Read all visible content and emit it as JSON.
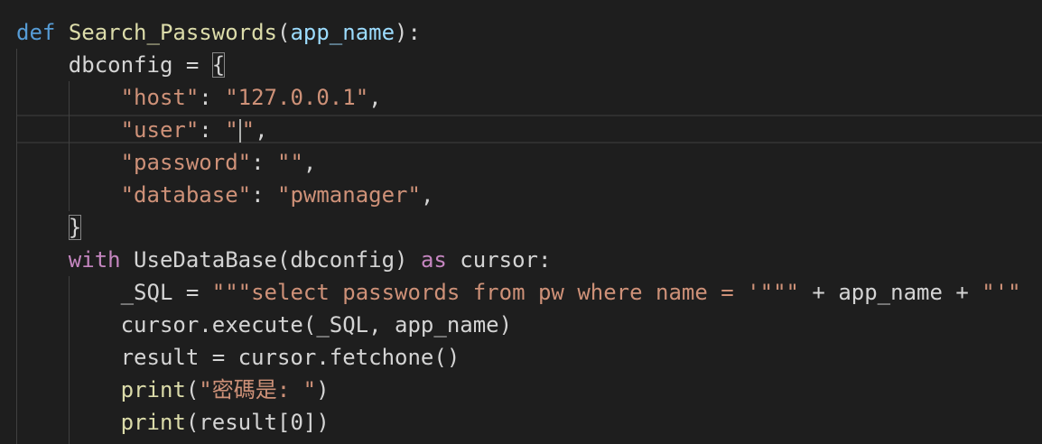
{
  "code": {
    "l1": {
      "def": "def",
      "name": "Search_Passwords",
      "open": "(",
      "param": "app_name",
      "close": "):"
    },
    "l2": {
      "text": "dbconfig = ",
      "brace": "{"
    },
    "l3": {
      "key": "\"host\"",
      "sep": ": ",
      "value": "\"127.0.0.1\"",
      "end": ","
    },
    "l4": {
      "key": "\"user\"",
      "sep": ": ",
      "value_open": "\"",
      "value_close": "\"",
      "end": ","
    },
    "l5": {
      "key": "\"password\"",
      "sep": ": ",
      "value": "\"\"",
      "end": ","
    },
    "l6": {
      "key": "\"database\"",
      "sep": ": ",
      "value": "\"pwmanager\"",
      "end": ","
    },
    "l7": {
      "brace": "}"
    },
    "l8": {
      "with": "with",
      "call": " UseDataBase(dbconfig) ",
      "as": "as",
      "rest": " cursor:"
    },
    "l9": {
      "lhs": "_SQL = ",
      "sql": "\"\"\"select passwords from pw where name = '\"\"\"",
      "plus": " + app_name + ",
      "tail": "\"'\""
    },
    "l10": {
      "text": "cursor.execute(_SQL, app_name)"
    },
    "l11": {
      "text": "result = cursor.fetchone()"
    },
    "l12": {
      "print": "print",
      "open": "(",
      "str": "\"密碼是: \"",
      "close": ")"
    },
    "l13": {
      "print": "print",
      "rest": "(result[0])"
    }
  }
}
